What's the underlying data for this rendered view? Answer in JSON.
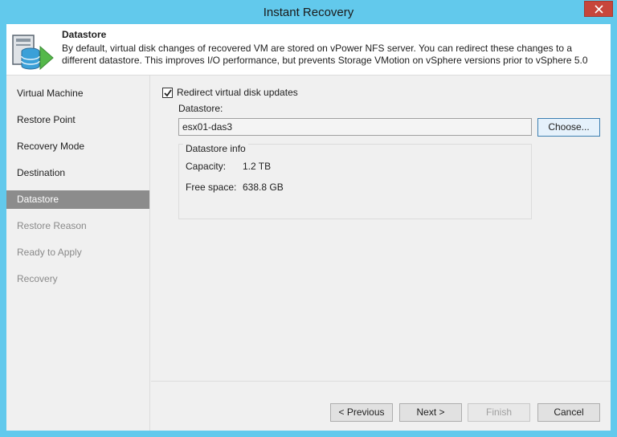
{
  "window": {
    "title": "Instant Recovery"
  },
  "header": {
    "title": "Datastore",
    "description": "By default, virtual disk changes of recovered VM are stored on vPower NFS server. You can redirect these changes to a different datastore. This improves I/O performance, but prevents Storage VMotion on vSphere versions prior to vSphere 5.0",
    "icon": "datastore-wizard-icon"
  },
  "sidebar": {
    "steps": [
      {
        "label": "Virtual Machine",
        "state": "done"
      },
      {
        "label": "Restore Point",
        "state": "done"
      },
      {
        "label": "Recovery Mode",
        "state": "done"
      },
      {
        "label": "Destination",
        "state": "done"
      },
      {
        "label": "Datastore",
        "state": "active"
      },
      {
        "label": "Restore Reason",
        "state": "disabled"
      },
      {
        "label": "Ready to Apply",
        "state": "disabled"
      },
      {
        "label": "Recovery",
        "state": "disabled"
      }
    ]
  },
  "content": {
    "redirect_checkbox": {
      "label": "Redirect virtual disk updates",
      "checked": true
    },
    "datastore_label": "Datastore:",
    "datastore_value": "esx01-das3",
    "choose_button": "Choose...",
    "info": {
      "title": "Datastore info",
      "capacity_label": "Capacity:",
      "capacity_value": "1.2 TB",
      "free_label": "Free space:",
      "free_value": "638.8 GB"
    }
  },
  "footer": {
    "previous": "< Previous",
    "next": "Next >",
    "finish": "Finish",
    "cancel": "Cancel"
  },
  "colors": {
    "frame": "#62c9ec",
    "active_step": "#8c8c8c",
    "close_button": "#c7463b"
  }
}
